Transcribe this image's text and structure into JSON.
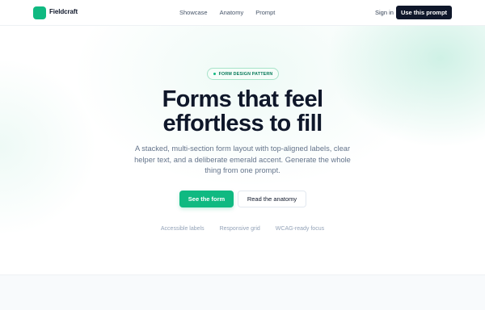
{
  "header": {
    "brand": "Fieldcraft",
    "nav": [
      "Showcase",
      "Anatomy",
      "Prompt"
    ],
    "sign_in": "Sign in",
    "cta": "Use this prompt"
  },
  "hero": {
    "badge": "FORM DESIGN PATTERN",
    "headline_line1": "Forms that feel",
    "headline_line2": "effortless to fill",
    "subtext": "A stacked, multi-section form layout with top-aligned labels, clear helper text, and a deliberate emerald accent. Generate the whole thing from one prompt.",
    "primary_button": "See the form",
    "secondary_button": "Read the anatomy",
    "features": [
      "Accessible labels",
      "Responsive grid",
      "WCAG-ready focus"
    ]
  },
  "colors": {
    "accent": "#10b981",
    "dark": "#0f172a",
    "muted": "#64748b"
  }
}
